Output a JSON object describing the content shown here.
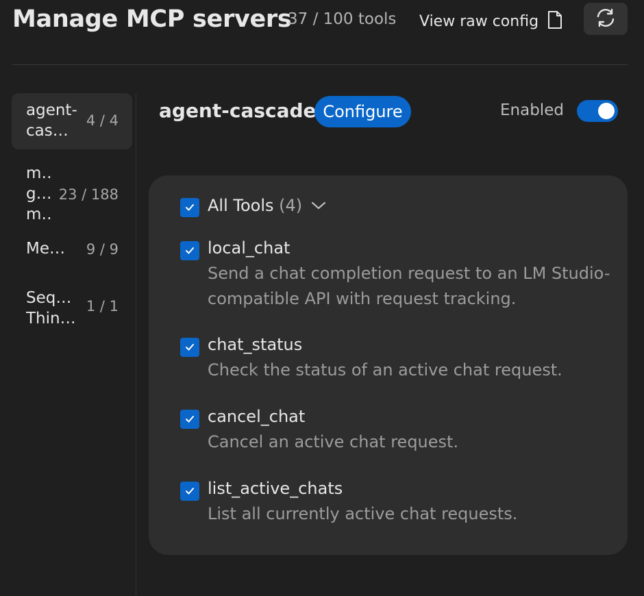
{
  "header": {
    "title": "Manage MCP servers",
    "tool_count": "37 / 100 tools",
    "view_raw_config": "View raw config",
    "file_icon": "file-icon",
    "refresh_icon": "refresh-icon"
  },
  "sidebar": {
    "items": [
      {
        "name": "agent-\ncas…",
        "count": "4 / 4",
        "active": true
      },
      {
        "name": "m‥\ng…\nm‥",
        "count": "23 / 188",
        "active": false
      },
      {
        "name": "Me…",
        "count": "9 / 9",
        "active": false
      },
      {
        "name": "Seq…\nThin…",
        "count": "1 / 1",
        "active": false
      }
    ]
  },
  "server": {
    "name": "agent-cascade",
    "configure_label": "Configure",
    "enabled_label": "Enabled",
    "enabled": true
  },
  "tools": {
    "all_label": "All Tools",
    "all_count": "(4)",
    "items": [
      {
        "name": "local_chat",
        "description": "Send a chat completion request to an LM Studio-compatible API with request tracking.",
        "checked": true
      },
      {
        "name": "chat_status",
        "description": "Check the status of an active chat request.",
        "checked": true
      },
      {
        "name": "cancel_chat",
        "description": "Cancel an active chat request.",
        "checked": true
      },
      {
        "name": "list_active_chats",
        "description": "List all currently active chat requests.",
        "checked": true
      }
    ]
  },
  "colors": {
    "accent": "#0a66c8",
    "background": "#1f1f1f",
    "panel": "#2e2e2e"
  }
}
